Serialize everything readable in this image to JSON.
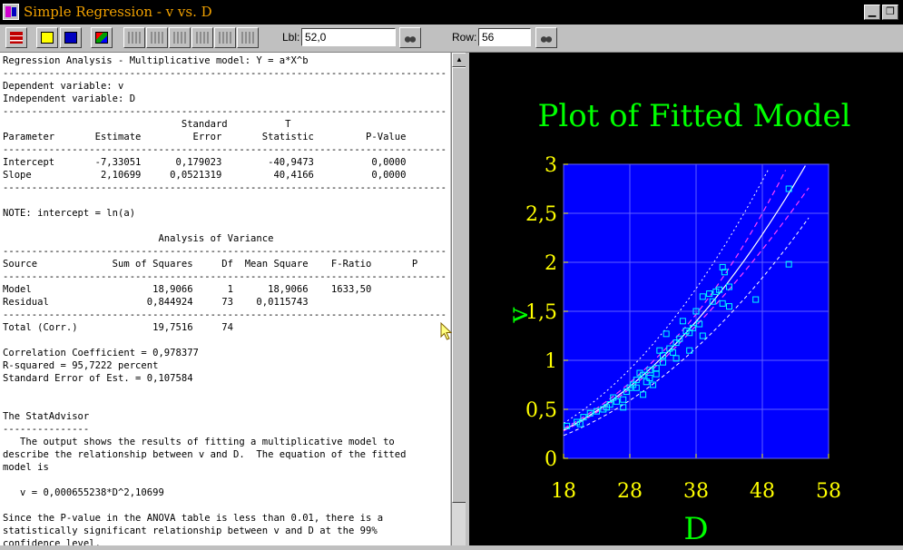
{
  "window": {
    "title": "Simple Regression - v vs. D",
    "minimize_glyph": "▁",
    "restore_glyph": "❐"
  },
  "toolbar": {
    "lbl_label": "Lbl:",
    "lbl_value": "52,0",
    "row_label": "Row:",
    "row_value": "56"
  },
  "report_lines": [
    "Regression Analysis - Multiplicative model: Y = a*X^b",
    "-----------------------------------------------------------------------------",
    "Dependent variable: v",
    "Independent variable: D",
    "-----------------------------------------------------------------------------",
    "                               Standard          T",
    "Parameter       Estimate         Error       Statistic         P-Value",
    "-----------------------------------------------------------------------------",
    "Intercept       -7,33051      0,179023        -40,9473          0,0000",
    "Slope            2,10699     0,0521319         40,4166          0,0000",
    "-----------------------------------------------------------------------------",
    "",
    "NOTE: intercept = ln(a)",
    "",
    "                           Analysis of Variance",
    "-----------------------------------------------------------------------------",
    "Source             Sum of Squares     Df  Mean Square    F-Ratio       P",
    "-----------------------------------------------------------------------------",
    "Model                     18,9066      1      18,9066    1633,50",
    "Residual                 0,844924     73    0,0115743",
    "-----------------------------------------------------------------------------",
    "Total (Corr.)             19,7516     74",
    "",
    "Correlation Coefficient = 0,978377",
    "R-squared = 95,7222 percent",
    "Standard Error of Est. = 0,107584",
    "",
    "",
    "The StatAdvisor",
    "---------------",
    "   The output shows the results of fitting a multiplicative model to",
    "describe the relationship between v and D.  The equation of the fitted",
    "model is",
    "",
    "   v = 0,000655238*D^2,10699",
    "",
    "Since the P-value in the ANOVA table is less than 0.01, there is a",
    "statistically significant relationship between v and D at the 99%",
    "confidence level."
  ],
  "colors": {
    "plot_background": "#0000ff",
    "title_color": "#00ff00",
    "tick_color": "#ffff00",
    "point_color": "#00ffff",
    "fit_line_color": "#ffffff",
    "confidence_color": "#ff40ff",
    "prediction_color": "#ffffff"
  },
  "chart_data": {
    "type": "scatter",
    "title": "Plot of Fitted Model",
    "xlabel": "D",
    "ylabel": "v",
    "xlim": [
      18,
      58
    ],
    "ylim": [
      0,
      3
    ],
    "x_ticks": [
      "18",
      "28",
      "38",
      "48",
      "58"
    ],
    "y_ticks": [
      "0",
      "0,5",
      "1",
      "1,5",
      "2",
      "2,5",
      "3"
    ],
    "grid": true,
    "fit": {
      "a": 0.000655238,
      "b": 2.10699,
      "x_range": [
        18,
        55
      ]
    },
    "points": [
      [
        18.5,
        0.33
      ],
      [
        20,
        0.37
      ],
      [
        20.5,
        0.35
      ],
      [
        21,
        0.42
      ],
      [
        22,
        0.46
      ],
      [
        23,
        0.48
      ],
      [
        24,
        0.5
      ],
      [
        24.5,
        0.52
      ],
      [
        25,
        0.55
      ],
      [
        25.5,
        0.62
      ],
      [
        26,
        0.58
      ],
      [
        27,
        0.6
      ],
      [
        27,
        0.52
      ],
      [
        27.5,
        0.68
      ],
      [
        28,
        0.72
      ],
      [
        28.5,
        0.75
      ],
      [
        29,
        0.8
      ],
      [
        29,
        0.72
      ],
      [
        29.5,
        0.87
      ],
      [
        30,
        0.85
      ],
      [
        30,
        0.65
      ],
      [
        30.5,
        0.78
      ],
      [
        31,
        0.9
      ],
      [
        31,
        0.82
      ],
      [
        31.5,
        0.75
      ],
      [
        32,
        0.92
      ],
      [
        32,
        0.86
      ],
      [
        32.5,
        1.1
      ],
      [
        33,
        1.05
      ],
      [
        33,
        0.98
      ],
      [
        33.5,
        1.27
      ],
      [
        34,
        1.12
      ],
      [
        34.5,
        1.08
      ],
      [
        35,
        1.18
      ],
      [
        35,
        1.02
      ],
      [
        35.5,
        1.22
      ],
      [
        36,
        1.4
      ],
      [
        36.5,
        1.3
      ],
      [
        37,
        1.28
      ],
      [
        37,
        1.1
      ],
      [
        37.5,
        1.33
      ],
      [
        38,
        1.5
      ],
      [
        38.5,
        1.37
      ],
      [
        39,
        1.65
      ],
      [
        39,
        1.25
      ],
      [
        40,
        1.68
      ],
      [
        40.5,
        1.6
      ],
      [
        41,
        1.7
      ],
      [
        41.5,
        1.72
      ],
      [
        42,
        1.58
      ],
      [
        42,
        1.95
      ],
      [
        42.3,
        1.9
      ],
      [
        43,
        1.75
      ],
      [
        43,
        1.55
      ],
      [
        47,
        1.62
      ],
      [
        52,
        2.75
      ],
      [
        52,
        1.98
      ]
    ]
  }
}
